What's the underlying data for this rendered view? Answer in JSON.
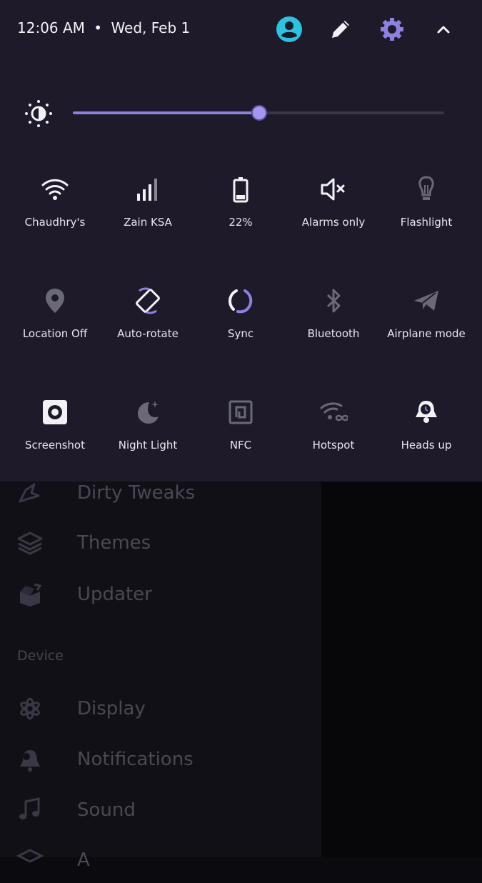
{
  "status": {
    "time": "12:06 AM",
    "separator": "•",
    "date": "Wed, Feb 1"
  },
  "header_icons": [
    "user-avatar-icon",
    "pencil-icon",
    "gear-icon",
    "chevron-up-icon"
  ],
  "accent_colors": {
    "primary": "#8c80e0",
    "avatar": "#2bc4e0",
    "panel_bg": "#1e1a29"
  },
  "brightness": {
    "level_fraction": 0.5
  },
  "tiles": [
    {
      "label": "Chaudhry's",
      "icon": "wifi-icon",
      "active": true
    },
    {
      "label": "Zain KSA",
      "icon": "cellular-signal-icon",
      "active": true
    },
    {
      "label": "22%",
      "icon": "battery-icon",
      "active": true
    },
    {
      "label": "Alarms only",
      "icon": "volume-muted-icon",
      "active": true
    },
    {
      "label": "Flashlight",
      "icon": "lightbulb-icon",
      "active": false
    },
    {
      "label": "Location Off",
      "icon": "location-pin-icon",
      "active": false
    },
    {
      "label": "Auto-rotate",
      "icon": "auto-rotate-icon",
      "active": true
    },
    {
      "label": "Sync",
      "icon": "sync-icon",
      "active": true
    },
    {
      "label": "Bluetooth",
      "icon": "bluetooth-icon",
      "active": false
    },
    {
      "label": "Airplane mode",
      "icon": "airplane-icon",
      "active": false
    },
    {
      "label": "Screenshot",
      "icon": "screenshot-icon",
      "active": true
    },
    {
      "label": "Night Light",
      "icon": "night-light-moon-icon",
      "active": false
    },
    {
      "label": "NFC",
      "icon": "nfc-icon",
      "active": false
    },
    {
      "label": "Hotspot",
      "icon": "hotspot-icon",
      "active": false
    },
    {
      "label": "Heads up",
      "icon": "heads-up-bell-icon",
      "active": true
    }
  ],
  "drawer": {
    "items_top": [
      {
        "label": "Dirty Tweaks",
        "icon": "dirty-tweaks-icon"
      },
      {
        "label": "Themes",
        "icon": "layers-icon"
      },
      {
        "label": "Updater",
        "icon": "package-icon"
      }
    ],
    "section_device": "Device",
    "items_device": [
      {
        "label": "Display",
        "icon": "display-flower-icon"
      },
      {
        "label": "Notifications",
        "icon": "notification-bell-icon"
      },
      {
        "label": "Sound",
        "icon": "music-note-icon"
      }
    ],
    "partial_item": {
      "label": "A",
      "icon": "layers-icon"
    }
  }
}
